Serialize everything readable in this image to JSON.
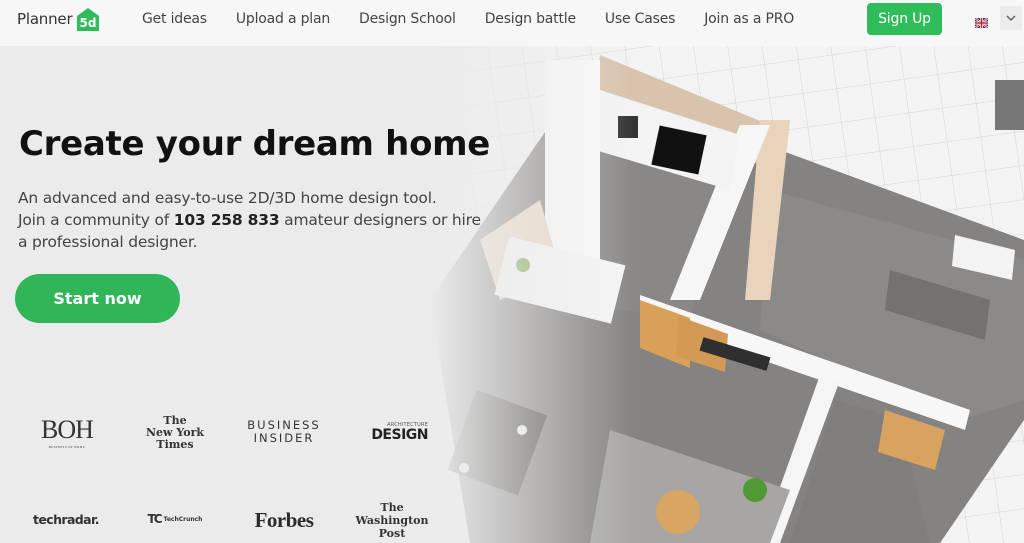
{
  "nav": {
    "logo_text": "Planner",
    "logo_badge": "5d",
    "links": [
      {
        "label": "Get ideas"
      },
      {
        "label": "Upload a plan"
      },
      {
        "label": "Design School"
      },
      {
        "label": "Design battle"
      },
      {
        "label": "Use Cases"
      },
      {
        "label": "Join as a PRO"
      }
    ],
    "signup_label": "Sign Up",
    "language_flag": "uk-flag-icon",
    "language_toggle_icon": "chevron-down-icon"
  },
  "hero": {
    "title": "Create your dream home",
    "desc_line1": "An advanced and easy-to-use 2D/3D home design tool.",
    "desc_line2_pre": "Join a community of ",
    "user_count": "103 258 833",
    "desc_line2_post": " amateur designers or hire",
    "desc_line3": "a professional designer.",
    "cta_label": "Start now"
  },
  "press": {
    "boh": "BOH",
    "boh_sub": "BUSINESS OF HOME",
    "nyt_lines": [
      "The",
      "New York",
      "Times"
    ],
    "bi_lines": [
      "BUSINESS",
      "INSIDER"
    ],
    "ad_small": "ARCHITECTURE",
    "ad_large": "DESIGN",
    "techradar": "techradar.",
    "techcrunch_mark": "TC",
    "techcrunch": "TechCrunch",
    "forbes": "Forbes",
    "wapo_lines": [
      "The",
      "Washington",
      "Post"
    ]
  },
  "colors": {
    "brand_green": "#2fbd5b",
    "cta_green": "#30b558",
    "page_bg": "#ebebeb",
    "nav_bg": "#f7f7f7"
  }
}
